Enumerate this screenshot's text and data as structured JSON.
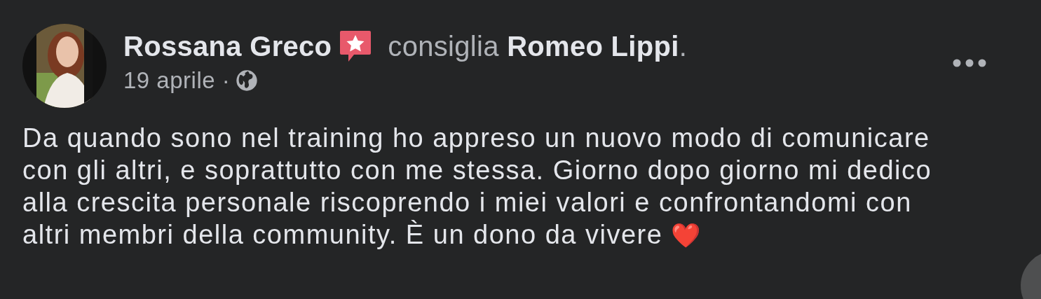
{
  "post": {
    "author": "Rossana Greco",
    "action": "consiglia **Romeo Lippi**.",
    "date": "19 aprile ·",
    "text": "Da quando sono nel training ho appreso un nuovo modo di comunicare\ncon gli altri, e soprattutto con me stessa. Giorno dopo giorno mi dedico\nalla crescita personale riscoprendo i miei valori e confrontandomi con\naltri membri della community. È un dono da vivere ❤️"
  }
}
